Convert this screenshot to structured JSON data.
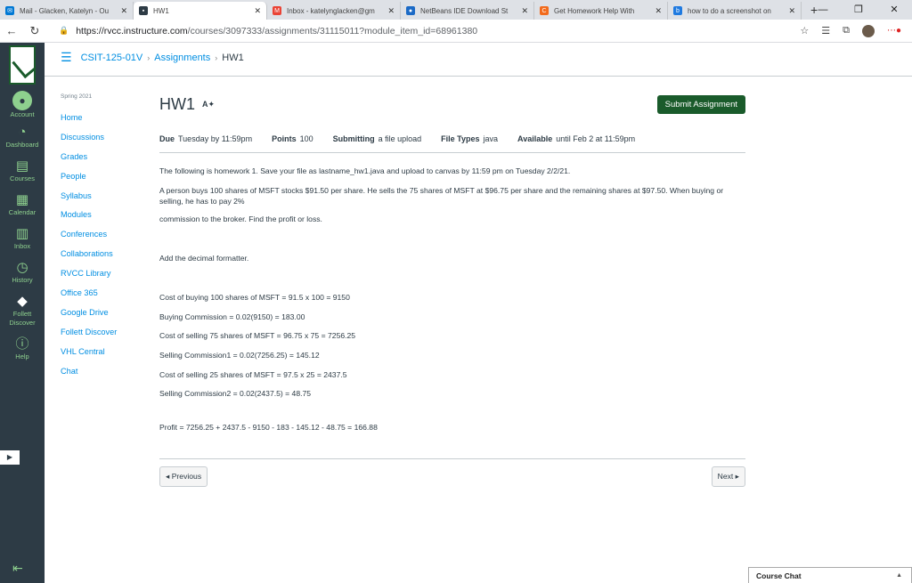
{
  "browser": {
    "tabs": [
      {
        "title": "Mail - Glacken, Katelyn - Ou",
        "color": "#0078d4",
        "active": false
      },
      {
        "title": "HW1",
        "color": "#2d3b45",
        "active": true
      },
      {
        "title": "Inbox - katelynglacken@gm",
        "color": "#ea4335",
        "active": false
      },
      {
        "title": "NetBeans IDE Download St",
        "color": "#1b6ac6",
        "active": false
      },
      {
        "title": "Get Homework Help With",
        "color": "#f26b1d",
        "active": false
      },
      {
        "title": "how to do a screenshot on",
        "color": "#1f7ae0",
        "active": false
      }
    ],
    "url_host": "https://rvcc.instructure.com",
    "url_path": "/courses/3097333/assignments/31115011?module_item_id=68961380"
  },
  "global_nav": {
    "items": [
      {
        "label": "Account",
        "icon": "account-icon"
      },
      {
        "label": "Dashboard",
        "icon": "dashboard-icon"
      },
      {
        "label": "Courses",
        "icon": "courses-icon"
      },
      {
        "label": "Calendar",
        "icon": "calendar-icon"
      },
      {
        "label": "Inbox",
        "icon": "inbox-icon"
      },
      {
        "label": "History",
        "icon": "history-icon"
      },
      {
        "label": "Follett Discover",
        "icon": "follett-icon"
      },
      {
        "label": "Help",
        "icon": "help-icon"
      }
    ]
  },
  "breadcrumb": {
    "course": "CSIT-125-01V",
    "section": "Assignments",
    "current": "HW1"
  },
  "course_nav": {
    "term": "Spring 2021",
    "items": [
      "Home",
      "Discussions",
      "Grades",
      "People",
      "Syllabus",
      "Modules",
      "Conferences",
      "Collaborations",
      "RVCC Library",
      "Office 365",
      "Google Drive",
      "Follett Discover",
      "VHL Central",
      "Chat"
    ]
  },
  "assignment": {
    "title": "HW1",
    "submit_label": "Submit Assignment",
    "meta": [
      {
        "label": "Due",
        "value": "Tuesday by 11:59pm"
      },
      {
        "label": "Points",
        "value": "100"
      },
      {
        "label": "Submitting",
        "value": "a file upload"
      },
      {
        "label": "File Types",
        "value": "java"
      },
      {
        "label": "Available",
        "value": "until Feb 2 at 11:59pm"
      }
    ],
    "p1": "The following is homework 1. Save your file as lastname_hw1.java and upload to canvas by 11:59 pm on Tuesday 2/2/21.",
    "p2": "A person buys 100 shares of MSFT stocks $91.50 per share. He sells the 75 shares of MSFT at $96.75 per share and the remaining shares at $97.50. When buying or selling, he has to pay 2%",
    "p3": "commission to the broker. Find the profit or loss.",
    "p4": "Add the decimal formatter.",
    "calc": [
      "Cost of buying 100 shares of MSFT = 91.5 x 100 = 9150",
      "Buying Commission = 0.02(9150) = 183.00",
      "Cost of selling 75 shares of MSFT = 96.75 x 75 = 7256.25",
      "Selling Commission1 = 0.02(7256.25) = 145.12",
      "Cost of selling 25 shares of MSFT = 97.5 x 25 = 2437.5",
      "Selling Commission2 = 0.02(2437.5) = 48.75"
    ],
    "profit": "Profit = 7256.25 + 2437.5 - 9150 - 183 - 145.12 - 48.75 = 166.88"
  },
  "pager": {
    "previous": "◂ Previous",
    "next": "Next ▸"
  },
  "course_chat": "Course Chat"
}
